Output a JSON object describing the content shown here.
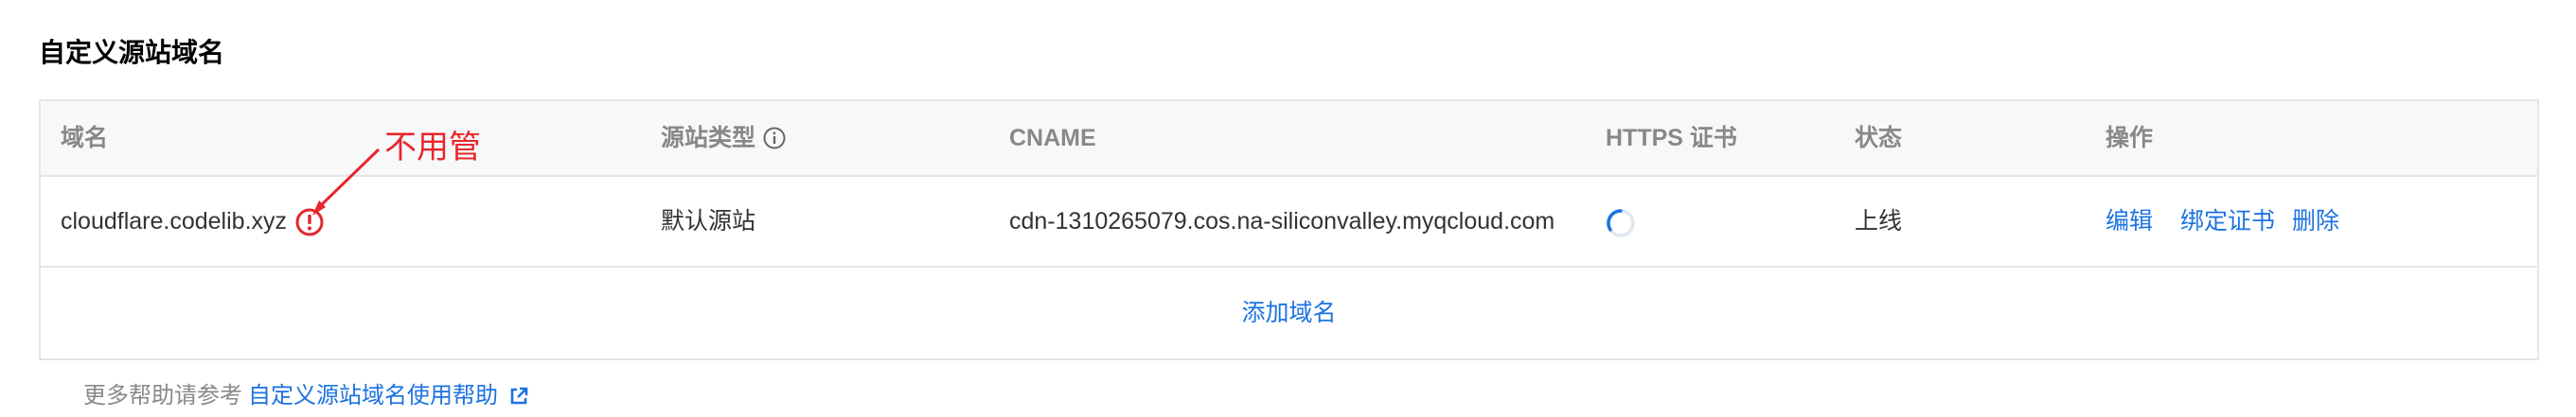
{
  "section_title": "自定义源站域名",
  "table": {
    "headers": {
      "domain": "域名",
      "origin_type": "源站类型",
      "cname": "CNAME",
      "https_cert": "HTTPS 证书",
      "status": "状态",
      "actions": "操作"
    },
    "rows": [
      {
        "domain": "cloudflare.codelib.xyz",
        "origin_type": "默认源站",
        "cname": "cdn-1310265079.cos.na-siliconvalley.myqcloud.com",
        "https_cert_state": "loading",
        "status": "上线",
        "actions": {
          "edit": "编辑",
          "bind_cert": "绑定证书",
          "delete": "删除"
        }
      }
    ],
    "add_domain_label": "添加域名"
  },
  "help": {
    "prefix": "更多帮助请参考",
    "link_text": "自定义源站域名使用帮助"
  },
  "annotation": {
    "text": "不用管",
    "color": "#e8262a"
  },
  "colors": {
    "link": "#1c73e0",
    "warning": "#e0282e",
    "header_bg": "#f7f8fa",
    "border": "#e3e5e8"
  },
  "icons": {
    "origin_type_info": "info-circle-icon",
    "domain_warning": "exclamation-circle-icon",
    "https_loading": "spinner-icon",
    "help_external": "external-link-icon"
  }
}
